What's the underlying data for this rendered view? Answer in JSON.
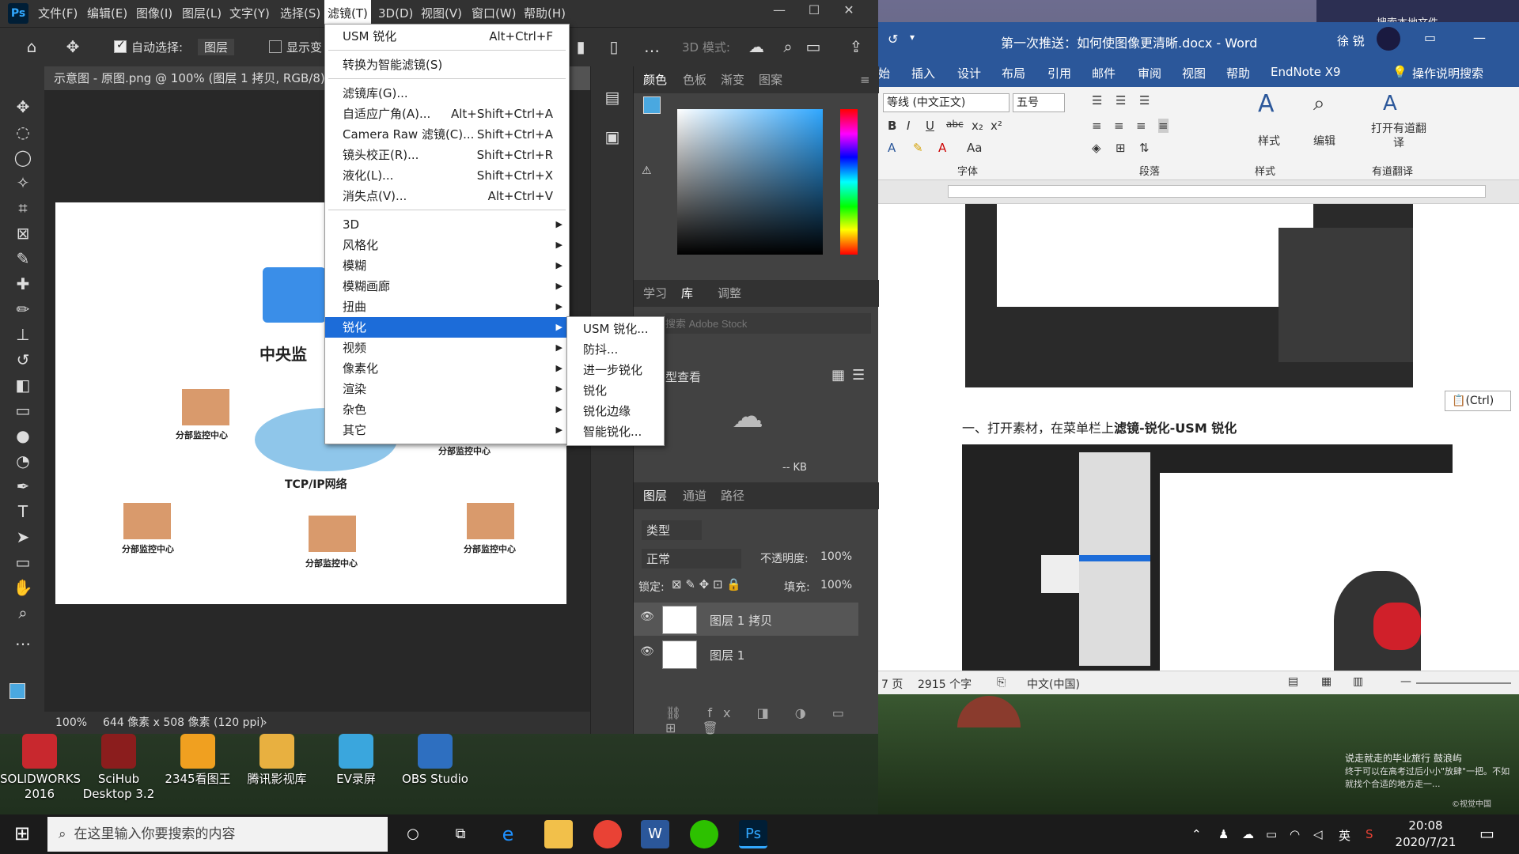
{
  "photoshop": {
    "logo": "Ps",
    "menus": [
      "文件(F)",
      "编辑(E)",
      "图像(I)",
      "图层(L)",
      "文字(Y)",
      "选择(S)",
      "滤镜(T)",
      "3D(D)",
      "视图(V)",
      "窗口(W)",
      "帮助(H)"
    ],
    "window_controls": [
      "—",
      "☐",
      "✕"
    ],
    "options": {
      "auto_select_label": "自动选择:",
      "auto_select_value": "图层",
      "show_transform_label": "显示变",
      "mode_3d_label": "3D 模式:"
    },
    "document_tab": "示意图 - 原图.png @ 100% (图层 1 拷贝, RGB/8) *",
    "status": {
      "zoom": "100%",
      "size": "644 像素 x 508 像素 (120 ppi)"
    },
    "canvas_labels": {
      "center": "中央监",
      "network": "TCP/IP网络",
      "branch": "分部监控中心"
    },
    "panels": {
      "color_tabs": [
        "颜色",
        "色板",
        "渐变",
        "图案"
      ],
      "library_tabs": [
        "学习",
        "库",
        "调整"
      ],
      "library_search_placeholder": "搜索 Adobe Stock",
      "library_view_label": "型查看",
      "library_size": "-- KB",
      "layer_tabs": [
        "图层",
        "通道",
        "路径"
      ],
      "layer_filter": "类型",
      "blend_mode": "正常",
      "opacity_label": "不透明度:",
      "opacity_value": "100%",
      "lock_label": "锁定:",
      "fill_label": "填充:",
      "fill_value": "100%",
      "layers": [
        "图层 1 拷贝",
        "图层 1"
      ]
    },
    "filter_menu": {
      "items": [
        {
          "label": "USM 锐化",
          "shortcut": "Alt+Ctrl+F"
        },
        {
          "label": "转换为智能滤镜(S)",
          "shortcut": ""
        },
        {
          "label": "滤镜库(G)...",
          "shortcut": ""
        },
        {
          "label": "自适应广角(A)...",
          "shortcut": "Alt+Shift+Ctrl+A"
        },
        {
          "label": "Camera Raw 滤镜(C)...",
          "shortcut": "Shift+Ctrl+A"
        },
        {
          "label": "镜头校正(R)...",
          "shortcut": "Shift+Ctrl+R"
        },
        {
          "label": "液化(L)...",
          "shortcut": "Shift+Ctrl+X"
        },
        {
          "label": "消失点(V)...",
          "shortcut": "Alt+Ctrl+V"
        },
        {
          "label": "3D"
        },
        {
          "label": "风格化"
        },
        {
          "label": "模糊"
        },
        {
          "label": "模糊画廊"
        },
        {
          "label": "扭曲"
        },
        {
          "label": "锐化"
        },
        {
          "label": "视频"
        },
        {
          "label": "像素化"
        },
        {
          "label": "渲染"
        },
        {
          "label": "杂色"
        },
        {
          "label": "其它"
        }
      ],
      "sharpen_submenu": [
        "USM 锐化...",
        "防抖...",
        "进一步锐化",
        "锐化",
        "锐化边缘",
        "智能锐化..."
      ]
    }
  },
  "word": {
    "title": "第一次推送：如何使图像更清晰.docx  -  Word",
    "user": "徐 锐",
    "tabs": [
      "始",
      "插入",
      "设计",
      "布局",
      "引用",
      "邮件",
      "审阅",
      "视图",
      "帮助",
      "EndNote X9"
    ],
    "tell_me": "操作说明搜索",
    "font_name": "等线 (中文正文)",
    "font_size": "五号",
    "groups": [
      "字体",
      "段落",
      "样式",
      "有道翻译"
    ],
    "big_buttons": [
      "样式",
      "编辑",
      "打开有道翻译"
    ],
    "paste_options": "(Ctrl)",
    "body_text_prefix": "一、打开素材，在菜单栏上",
    "body_text_bold": "滤镜-锐化-USM 锐化",
    "status": {
      "page": "7 页",
      "words": "2915 个字",
      "language": "中文(中国)"
    }
  },
  "desktop": {
    "icons": [
      {
        "label": "SOLIDWORKS 2016",
        "color": "#c8282e"
      },
      {
        "label": "SciHub Desktop 3.2",
        "color": "#8b1d1d"
      },
      {
        "label": "2345看图王",
        "color": "#f0a020"
      },
      {
        "label": "腾讯影视库",
        "color": "#e8b040"
      },
      {
        "label": "EV录屏",
        "color": "#3aa6dd"
      },
      {
        "label": "OBS Studio",
        "color": "#2e6fc0"
      }
    ],
    "wallpaper_caption": "说走就走的毕业旅行 鼓浪屿",
    "wallpaper_caption2": "终于可以在高考过后小小\"放肆\"一把。不如就找个合适的地方走一...",
    "wallpaper_credit": "©视觉中国",
    "top_right_text": "搜索本地文件"
  },
  "taskbar": {
    "search_placeholder": "在这里输入你要搜索的内容",
    "ime": "英",
    "time": "20:08",
    "date": "2020/7/21"
  },
  "colors": {
    "ps_dark": "#323232",
    "ps_mid": "#424242",
    "menu_highlight": "#1c6cd9",
    "word_blue": "#2b579a",
    "taskbar": "#1b1b1b"
  }
}
